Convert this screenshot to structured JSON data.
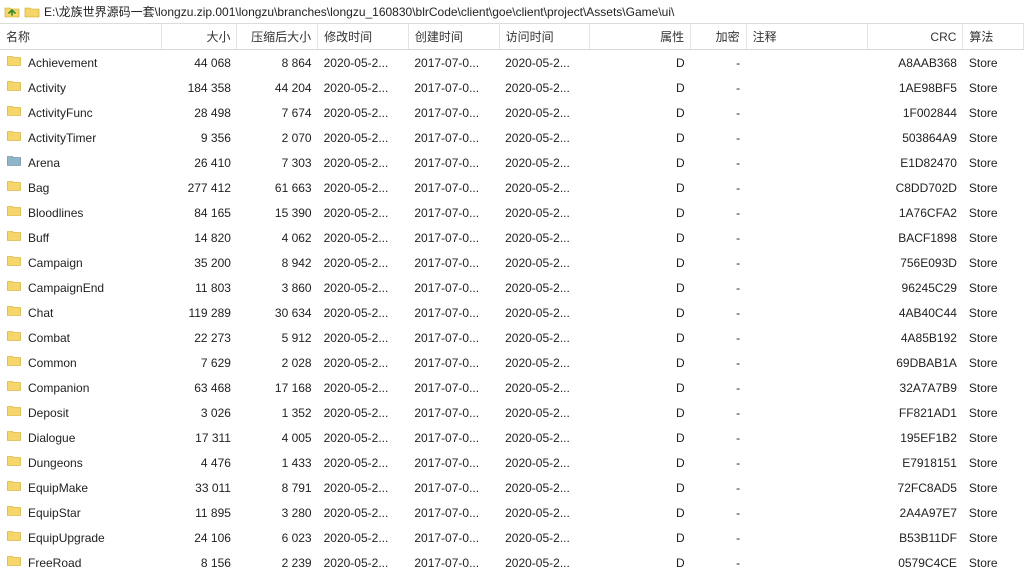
{
  "path": "E:\\龙族世界源码一套\\longzu.zip.001\\longzu\\branches\\longzu_160830\\blrCode\\client\\goe\\client\\project\\Assets\\Game\\ui\\",
  "columns": {
    "name": "名称",
    "size": "大小",
    "packed": "压缩后大小",
    "modified": "修改时间",
    "created": "创建时间",
    "accessed": "访问时间",
    "attr": "属性",
    "encrypted": "加密",
    "comment": "注释",
    "crc": "CRC",
    "method": "算法"
  },
  "rows": [
    {
      "name": "Achievement",
      "size": "44 068",
      "packed": "8 864",
      "modified": "2020-05-2...",
      "created": "2017-07-0...",
      "accessed": "2020-05-2...",
      "attr": "D",
      "encrypted": "-",
      "comment": "",
      "crc": "A8AAB368",
      "method": "Store"
    },
    {
      "name": "Activity",
      "size": "184 358",
      "packed": "44 204",
      "modified": "2020-05-2...",
      "created": "2017-07-0...",
      "accessed": "2020-05-2...",
      "attr": "D",
      "encrypted": "-",
      "comment": "",
      "crc": "1AE98BF5",
      "method": "Store"
    },
    {
      "name": "ActivityFunc",
      "size": "28 498",
      "packed": "7 674",
      "modified": "2020-05-2...",
      "created": "2017-07-0...",
      "accessed": "2020-05-2...",
      "attr": "D",
      "encrypted": "-",
      "comment": "",
      "crc": "1F002844",
      "method": "Store"
    },
    {
      "name": "ActivityTimer",
      "size": "9 356",
      "packed": "2 070",
      "modified": "2020-05-2...",
      "created": "2017-07-0...",
      "accessed": "2020-05-2...",
      "attr": "D",
      "encrypted": "-",
      "comment": "",
      "crc": "503864A9",
      "method": "Store"
    },
    {
      "name": "Arena",
      "size": "26 410",
      "packed": "7 303",
      "modified": "2020-05-2...",
      "created": "2017-07-0...",
      "accessed": "2020-05-2...",
      "attr": "D",
      "encrypted": "-",
      "comment": "",
      "crc": "E1D82470",
      "method": "Store",
      "alt": true
    },
    {
      "name": "Bag",
      "size": "277 412",
      "packed": "61 663",
      "modified": "2020-05-2...",
      "created": "2017-07-0...",
      "accessed": "2020-05-2...",
      "attr": "D",
      "encrypted": "-",
      "comment": "",
      "crc": "C8DD702D",
      "method": "Store"
    },
    {
      "name": "Bloodlines",
      "size": "84 165",
      "packed": "15 390",
      "modified": "2020-05-2...",
      "created": "2017-07-0...",
      "accessed": "2020-05-2...",
      "attr": "D",
      "encrypted": "-",
      "comment": "",
      "crc": "1A76CFA2",
      "method": "Store"
    },
    {
      "name": "Buff",
      "size": "14 820",
      "packed": "4 062",
      "modified": "2020-05-2...",
      "created": "2017-07-0...",
      "accessed": "2020-05-2...",
      "attr": "D",
      "encrypted": "-",
      "comment": "",
      "crc": "BACF1898",
      "method": "Store"
    },
    {
      "name": "Campaign",
      "size": "35 200",
      "packed": "8 942",
      "modified": "2020-05-2...",
      "created": "2017-07-0...",
      "accessed": "2020-05-2...",
      "attr": "D",
      "encrypted": "-",
      "comment": "",
      "crc": "756E093D",
      "method": "Store"
    },
    {
      "name": "CampaignEnd",
      "size": "11 803",
      "packed": "3 860",
      "modified": "2020-05-2...",
      "created": "2017-07-0...",
      "accessed": "2020-05-2...",
      "attr": "D",
      "encrypted": "-",
      "comment": "",
      "crc": "96245C29",
      "method": "Store"
    },
    {
      "name": "Chat",
      "size": "119 289",
      "packed": "30 634",
      "modified": "2020-05-2...",
      "created": "2017-07-0...",
      "accessed": "2020-05-2...",
      "attr": "D",
      "encrypted": "-",
      "comment": "",
      "crc": "4AB40C44",
      "method": "Store"
    },
    {
      "name": "Combat",
      "size": "22 273",
      "packed": "5 912",
      "modified": "2020-05-2...",
      "created": "2017-07-0...",
      "accessed": "2020-05-2...",
      "attr": "D",
      "encrypted": "-",
      "comment": "",
      "crc": "4A85B192",
      "method": "Store"
    },
    {
      "name": "Common",
      "size": "7 629",
      "packed": "2 028",
      "modified": "2020-05-2...",
      "created": "2017-07-0...",
      "accessed": "2020-05-2...",
      "attr": "D",
      "encrypted": "-",
      "comment": "",
      "crc": "69DBAB1A",
      "method": "Store"
    },
    {
      "name": "Companion",
      "size": "63 468",
      "packed": "17 168",
      "modified": "2020-05-2...",
      "created": "2017-07-0...",
      "accessed": "2020-05-2...",
      "attr": "D",
      "encrypted": "-",
      "comment": "",
      "crc": "32A7A7B9",
      "method": "Store"
    },
    {
      "name": "Deposit",
      "size": "3 026",
      "packed": "1 352",
      "modified": "2020-05-2...",
      "created": "2017-07-0...",
      "accessed": "2020-05-2...",
      "attr": "D",
      "encrypted": "-",
      "comment": "",
      "crc": "FF821AD1",
      "method": "Store"
    },
    {
      "name": "Dialogue",
      "size": "17 311",
      "packed": "4 005",
      "modified": "2020-05-2...",
      "created": "2017-07-0...",
      "accessed": "2020-05-2...",
      "attr": "D",
      "encrypted": "-",
      "comment": "",
      "crc": "195EF1B2",
      "method": "Store"
    },
    {
      "name": "Dungeons",
      "size": "4 476",
      "packed": "1 433",
      "modified": "2020-05-2...",
      "created": "2017-07-0...",
      "accessed": "2020-05-2...",
      "attr": "D",
      "encrypted": "-",
      "comment": "",
      "crc": "E7918151",
      "method": "Store"
    },
    {
      "name": "EquipMake",
      "size": "33 011",
      "packed": "8 791",
      "modified": "2020-05-2...",
      "created": "2017-07-0...",
      "accessed": "2020-05-2...",
      "attr": "D",
      "encrypted": "-",
      "comment": "",
      "crc": "72FC8AD5",
      "method": "Store"
    },
    {
      "name": "EquipStar",
      "size": "11 895",
      "packed": "3 280",
      "modified": "2020-05-2...",
      "created": "2017-07-0...",
      "accessed": "2020-05-2...",
      "attr": "D",
      "encrypted": "-",
      "comment": "",
      "crc": "2A4A97E7",
      "method": "Store"
    },
    {
      "name": "EquipUpgrade",
      "size": "24 106",
      "packed": "6 023",
      "modified": "2020-05-2...",
      "created": "2017-07-0...",
      "accessed": "2020-05-2...",
      "attr": "D",
      "encrypted": "-",
      "comment": "",
      "crc": "B53B11DF",
      "method": "Store"
    },
    {
      "name": "FreeRoad",
      "size": "8 156",
      "packed": "2 239",
      "modified": "2020-05-2...",
      "created": "2017-07-0...",
      "accessed": "2020-05-2...",
      "attr": "D",
      "encrypted": "-",
      "comment": "",
      "crc": "0579C4CE",
      "method": "Store"
    }
  ]
}
